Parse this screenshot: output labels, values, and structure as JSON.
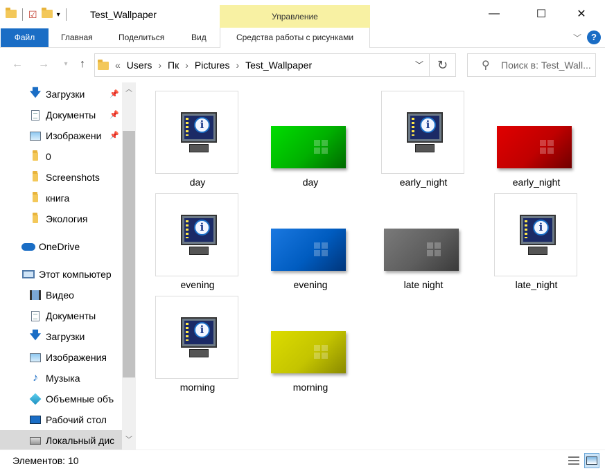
{
  "window": {
    "title": "Test_Wallpaper",
    "context_group": "Управление",
    "controls": {
      "minimize": "—",
      "maximize": "☐",
      "close": "✕"
    }
  },
  "ribbon": {
    "tabs": [
      "Файл",
      "Главная",
      "Поделиться",
      "Вид"
    ],
    "context_tab": "Средства работы с рисунками",
    "help": "?"
  },
  "address": {
    "crumbs": [
      "«",
      "Users",
      "›",
      "Пк",
      "›",
      "Pictures",
      "›",
      "Test_Wallpaper"
    ],
    "search_placeholder": "Поиск в: Test_Wall..."
  },
  "sidebar": {
    "items": [
      {
        "label": "Загрузки",
        "icon": "downloads-icon",
        "pinned": true
      },
      {
        "label": "Документы",
        "icon": "documents-icon",
        "pinned": true
      },
      {
        "label": "Изображени",
        "icon": "pictures-icon",
        "pinned": true
      },
      {
        "label": "0",
        "icon": "folder-icon"
      },
      {
        "label": "Screenshots",
        "icon": "folder-icon"
      },
      {
        "label": "книга",
        "icon": "folder-icon"
      },
      {
        "label": "Экология",
        "icon": "folder-icon"
      },
      {
        "label": "OneDrive",
        "icon": "onedrive-icon"
      },
      {
        "label": "Этот компьютер",
        "icon": "this-pc-icon"
      },
      {
        "label": "Видео",
        "icon": "videos-icon"
      },
      {
        "label": "Документы",
        "icon": "documents-icon"
      },
      {
        "label": "Загрузки",
        "icon": "downloads-icon"
      },
      {
        "label": "Изображения",
        "icon": "pictures-icon"
      },
      {
        "label": "Музыка",
        "icon": "music-icon"
      },
      {
        "label": "Объемные объ",
        "icon": "3d-objects-icon"
      },
      {
        "label": "Рабочий стол",
        "icon": "desktop-icon"
      },
      {
        "label": "Локальный дис",
        "icon": "local-disk-icon"
      }
    ]
  },
  "files": [
    {
      "name": "day",
      "kind": "theme",
      "color": ""
    },
    {
      "name": "day",
      "kind": "image",
      "color": "#00c800"
    },
    {
      "name": "early_night",
      "kind": "theme",
      "color": ""
    },
    {
      "name": "early_night",
      "kind": "image",
      "color": "#c80000"
    },
    {
      "name": "evening",
      "kind": "theme",
      "color": ""
    },
    {
      "name": "evening",
      "kind": "image",
      "color": "#0064c8"
    },
    {
      "name": "late night",
      "kind": "image",
      "color": "#646464"
    },
    {
      "name": "late_night",
      "kind": "theme",
      "color": ""
    },
    {
      "name": "morning",
      "kind": "theme",
      "color": ""
    },
    {
      "name": "morning",
      "kind": "image",
      "color": "#c8c800"
    }
  ],
  "status": {
    "count": "Элементов: 10"
  },
  "colors": {
    "accent": "#1a6dc5",
    "context_tab": "#f8f1a3"
  }
}
